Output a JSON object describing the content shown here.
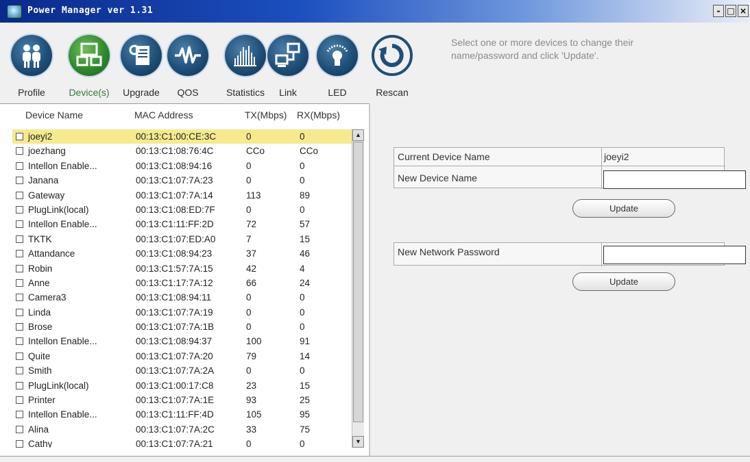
{
  "window": {
    "title": "Power Manager ver 1.31",
    "controls": {
      "minimize": "-",
      "maximize": "□",
      "close": "×"
    }
  },
  "toolbar": {
    "items": [
      {
        "label": "Profile",
        "icon": "people-icon",
        "active": false
      },
      {
        "label": "Device(s)",
        "icon": "devices-icon",
        "active": true
      },
      {
        "label": "Upgrade",
        "icon": "upgrade-icon",
        "active": false
      },
      {
        "label": "QOS",
        "icon": "waveform-icon",
        "active": false
      },
      {
        "label": "Statistics",
        "icon": "bar-chart-icon",
        "active": false
      },
      {
        "label": "Link",
        "icon": "network-icon",
        "active": false
      },
      {
        "label": "LED",
        "icon": "led-icon",
        "active": false
      },
      {
        "label": "Rescan",
        "icon": "refresh-icon",
        "active": false
      }
    ]
  },
  "hint": "Select one or more devices to change their name/password and click 'Update'.",
  "device_list": {
    "columns": [
      "Device Name",
      "MAC Address",
      "TX(Mbps)",
      "RX(Mbps)"
    ],
    "rows": [
      {
        "name": "joeyi2",
        "mac": "00:13:C1:00:CE:3C",
        "tx": "0",
        "rx": "0",
        "selected": true
      },
      {
        "name": "joezhang",
        "mac": "00:13:C1:08:76:4C",
        "tx": "CCo",
        "rx": "CCo"
      },
      {
        "name": "Intellon Enable...",
        "mac": "00:13:C1:08:94:16",
        "tx": "0",
        "rx": "0"
      },
      {
        "name": "Janana",
        "mac": "00:13:C1:07:7A:23",
        "tx": "0",
        "rx": "0"
      },
      {
        "name": "Gateway",
        "mac": "00:13:C1:07:7A:14",
        "tx": "113",
        "rx": "89"
      },
      {
        "name": "PlugLink(local)",
        "mac": "00:13:C1:08:ED:7F",
        "tx": "0",
        "rx": "0"
      },
      {
        "name": "Intellon Enable...",
        "mac": "00:13:C1:11:FF:2D",
        "tx": "72",
        "rx": "57"
      },
      {
        "name": "TKTK",
        "mac": "00:13:C1:07:ED:A0",
        "tx": "7",
        "rx": "15"
      },
      {
        "name": "Attandance",
        "mac": "00:13:C1:08:94:23",
        "tx": "37",
        "rx": "46"
      },
      {
        "name": "Robin",
        "mac": "00:13:C1:57:7A:15",
        "tx": "42",
        "rx": "4"
      },
      {
        "name": "Anne",
        "mac": "00:13:C1:17:7A:12",
        "tx": "66",
        "rx": "24"
      },
      {
        "name": "Camera3",
        "mac": "00:13:C1:08:94:11",
        "tx": "0",
        "rx": "0"
      },
      {
        "name": "Linda",
        "mac": "00:13:C1:07:7A:19",
        "tx": "0",
        "rx": "0"
      },
      {
        "name": "Brose",
        "mac": "00:13:C1:07:7A:1B",
        "tx": "0",
        "rx": "0"
      },
      {
        "name": "Intellon Enable...",
        "mac": "00:13:C1:08:94:37",
        "tx": "100",
        "rx": "91"
      },
      {
        "name": "Quite",
        "mac": "00:13:C1:07:7A:20",
        "tx": "79",
        "rx": "14"
      },
      {
        "name": "Smith",
        "mac": "00:13:C1:07:7A:2A",
        "tx": "0",
        "rx": "0"
      },
      {
        "name": "PlugLink(local)",
        "mac": "00:13:C1:00:17:C8",
        "tx": "23",
        "rx": "15"
      },
      {
        "name": "Printer",
        "mac": "00:13:C1:07:7A:1E",
        "tx": "93",
        "rx": "25"
      },
      {
        "name": "Intellon Enable...",
        "mac": "00:13:C1:11:FF:4D",
        "tx": "105",
        "rx": "95"
      },
      {
        "name": "Alina",
        "mac": "00:13:C1:07:7A:2C",
        "tx": "33",
        "rx": "75"
      },
      {
        "name": "Cathy",
        "mac": "00:13:C1:07:7A:21",
        "tx": "0",
        "rx": "0"
      }
    ]
  },
  "form": {
    "current_device_name_label": "Current Device Name",
    "current_device_name_value": "joeyi2",
    "new_device_name_label": "New Device Name",
    "new_device_name_value": "",
    "update_label": "Update",
    "new_network_password_label": "New Network Password",
    "new_network_password_value": "",
    "update_password_label": "Update"
  },
  "colors": {
    "title_gradient_start": "#0a2a8a",
    "selected_row": "#f5ea8e",
    "active_tool_label": "#2e7d32"
  }
}
